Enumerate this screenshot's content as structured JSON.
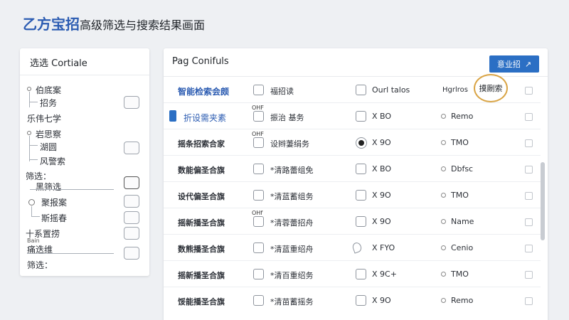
{
  "title": {
    "brand": "乙方宝招",
    "rest": "高级筛选与搜索结果画面"
  },
  "sidebar": {
    "header": "选选 Cortiale",
    "items": [
      {
        "label": "伯底案"
      },
      {
        "label": "招务"
      },
      {
        "label": "乐伟七学"
      },
      {
        "label": "岩思察"
      },
      {
        "label": "湖圆"
      },
      {
        "label": "风警索"
      },
      {
        "label": "筛选："
      },
      {
        "label": "黑筛选"
      },
      {
        "label": "聚报案"
      },
      {
        "label": "斯摇春"
      },
      {
        "label": "十系置捞"
      },
      {
        "label": "Bain"
      },
      {
        "label": "痛迭维"
      },
      {
        "label": "筛选："
      }
    ]
  },
  "main": {
    "header": "Pag Conifuls",
    "button": {
      "label": "意业招",
      "icon": "arrow-up-right-icon"
    },
    "columns": {
      "c1": "智能检索会颇",
      "c2": "福招读",
      "c3": "Ourl talos",
      "c4": "Hgrlros",
      "c5_highlight": "摸劂索"
    },
    "rows": [
      {
        "name": "折设需夹素",
        "off": "OHF",
        "c2": "振治 基务",
        "c3": "X BO",
        "c4": "Remo"
      },
      {
        "name": "摇条招索合家",
        "off": "OHF",
        "c2": "设辫萋绢务",
        "c3": "X 9O",
        "c4": "TMO",
        "selected": true
      },
      {
        "name": "数能偏圣合旗",
        "c2": "*清路蕾组免",
        "c3": "X BO",
        "c4": "Dbfsc"
      },
      {
        "name": "设代偏圣合旗",
        "c2": "*清蓝蓄组务",
        "c3": "X 9O",
        "c4": "TMO"
      },
      {
        "name": "摇新播圣合旗",
        "off": "OHf",
        "c2": "*清蓉蕾招舟",
        "c3": "X 9O",
        "c4": "Name"
      },
      {
        "name": "数熊播圣合旗",
        "c2": "*清蓝重绍舟",
        "c3": "X FYO",
        "c4": "Cenio",
        "bubble": true
      },
      {
        "name": "摇新播圣合旗",
        "c2": "*清百重绍务",
        "c3": "X 9C+",
        "c4": "TMO"
      },
      {
        "name": "馁能播圣合旗",
        "c2": "*清苗蓄摇务",
        "c3": "X 9O",
        "c4": "Remo"
      }
    ]
  },
  "colors": {
    "accent": "#2b6fc4",
    "highlight": "#d9a445",
    "brand": "#2c5cb2"
  }
}
